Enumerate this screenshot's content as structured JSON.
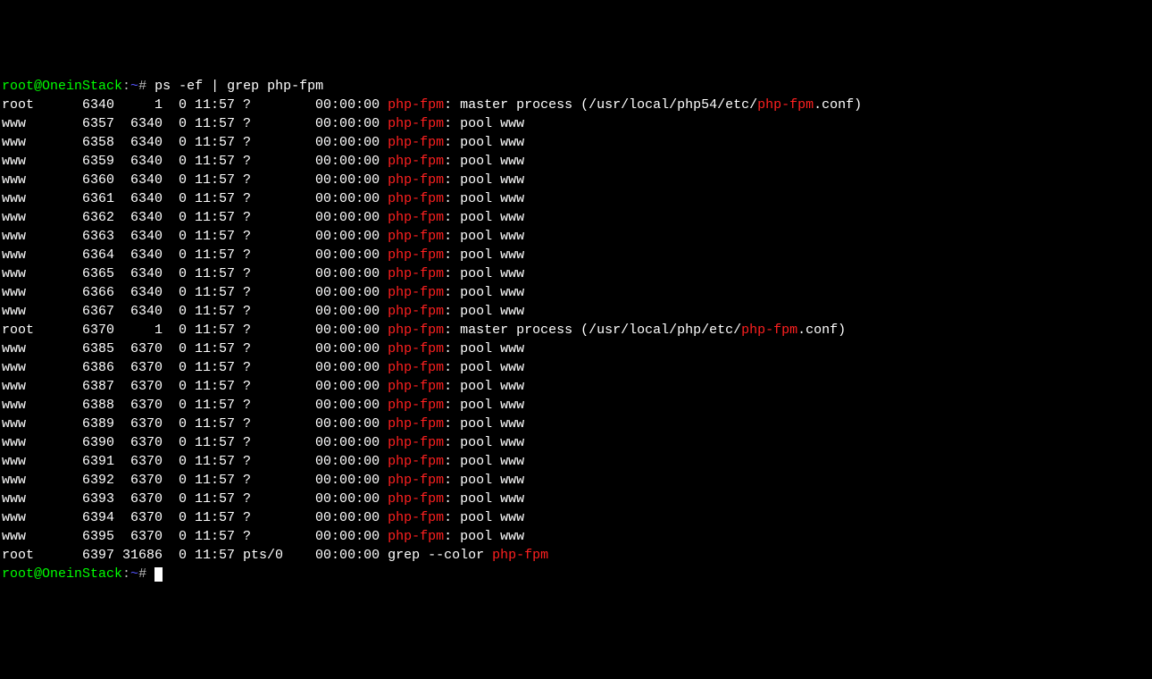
{
  "prompt": {
    "user_host": "root@OneinStack",
    "separator": ":",
    "path": "~",
    "hash": "#",
    "command": " ps -ef | grep php-fpm"
  },
  "final_prompt": {
    "user_host": "root@OneinStack",
    "separator": ":",
    "path": "~",
    "hash": "#"
  },
  "highlight": "php-fpm",
  "processes": [
    {
      "user": "root",
      "pid": "6340",
      "ppid": "1",
      "c": "0",
      "stime": "11:57",
      "tty": "?",
      "time": "00:00:00",
      "cmd_pre": ": master process (/usr/local/php54/etc/",
      "cmd_post": ".conf)"
    },
    {
      "user": "www",
      "pid": "6357",
      "ppid": "6340",
      "c": "0",
      "stime": "11:57",
      "tty": "?",
      "time": "00:00:00",
      "cmd_pre": ": pool www",
      "cmd_post": ""
    },
    {
      "user": "www",
      "pid": "6358",
      "ppid": "6340",
      "c": "0",
      "stime": "11:57",
      "tty": "?",
      "time": "00:00:00",
      "cmd_pre": ": pool www",
      "cmd_post": ""
    },
    {
      "user": "www",
      "pid": "6359",
      "ppid": "6340",
      "c": "0",
      "stime": "11:57",
      "tty": "?",
      "time": "00:00:00",
      "cmd_pre": ": pool www",
      "cmd_post": ""
    },
    {
      "user": "www",
      "pid": "6360",
      "ppid": "6340",
      "c": "0",
      "stime": "11:57",
      "tty": "?",
      "time": "00:00:00",
      "cmd_pre": ": pool www",
      "cmd_post": ""
    },
    {
      "user": "www",
      "pid": "6361",
      "ppid": "6340",
      "c": "0",
      "stime": "11:57",
      "tty": "?",
      "time": "00:00:00",
      "cmd_pre": ": pool www",
      "cmd_post": ""
    },
    {
      "user": "www",
      "pid": "6362",
      "ppid": "6340",
      "c": "0",
      "stime": "11:57",
      "tty": "?",
      "time": "00:00:00",
      "cmd_pre": ": pool www",
      "cmd_post": ""
    },
    {
      "user": "www",
      "pid": "6363",
      "ppid": "6340",
      "c": "0",
      "stime": "11:57",
      "tty": "?",
      "time": "00:00:00",
      "cmd_pre": ": pool www",
      "cmd_post": ""
    },
    {
      "user": "www",
      "pid": "6364",
      "ppid": "6340",
      "c": "0",
      "stime": "11:57",
      "tty": "?",
      "time": "00:00:00",
      "cmd_pre": ": pool www",
      "cmd_post": ""
    },
    {
      "user": "www",
      "pid": "6365",
      "ppid": "6340",
      "c": "0",
      "stime": "11:57",
      "tty": "?",
      "time": "00:00:00",
      "cmd_pre": ": pool www",
      "cmd_post": ""
    },
    {
      "user": "www",
      "pid": "6366",
      "ppid": "6340",
      "c": "0",
      "stime": "11:57",
      "tty": "?",
      "time": "00:00:00",
      "cmd_pre": ": pool www",
      "cmd_post": ""
    },
    {
      "user": "www",
      "pid": "6367",
      "ppid": "6340",
      "c": "0",
      "stime": "11:57",
      "tty": "?",
      "time": "00:00:00",
      "cmd_pre": ": pool www",
      "cmd_post": ""
    },
    {
      "user": "root",
      "pid": "6370",
      "ppid": "1",
      "c": "0",
      "stime": "11:57",
      "tty": "?",
      "time": "00:00:00",
      "cmd_pre": ": master process (/usr/local/php/etc/",
      "cmd_post": ".conf)"
    },
    {
      "user": "www",
      "pid": "6385",
      "ppid": "6370",
      "c": "0",
      "stime": "11:57",
      "tty": "?",
      "time": "00:00:00",
      "cmd_pre": ": pool www",
      "cmd_post": ""
    },
    {
      "user": "www",
      "pid": "6386",
      "ppid": "6370",
      "c": "0",
      "stime": "11:57",
      "tty": "?",
      "time": "00:00:00",
      "cmd_pre": ": pool www",
      "cmd_post": ""
    },
    {
      "user": "www",
      "pid": "6387",
      "ppid": "6370",
      "c": "0",
      "stime": "11:57",
      "tty": "?",
      "time": "00:00:00",
      "cmd_pre": ": pool www",
      "cmd_post": ""
    },
    {
      "user": "www",
      "pid": "6388",
      "ppid": "6370",
      "c": "0",
      "stime": "11:57",
      "tty": "?",
      "time": "00:00:00",
      "cmd_pre": ": pool www",
      "cmd_post": ""
    },
    {
      "user": "www",
      "pid": "6389",
      "ppid": "6370",
      "c": "0",
      "stime": "11:57",
      "tty": "?",
      "time": "00:00:00",
      "cmd_pre": ": pool www",
      "cmd_post": ""
    },
    {
      "user": "www",
      "pid": "6390",
      "ppid": "6370",
      "c": "0",
      "stime": "11:57",
      "tty": "?",
      "time": "00:00:00",
      "cmd_pre": ": pool www",
      "cmd_post": ""
    },
    {
      "user": "www",
      "pid": "6391",
      "ppid": "6370",
      "c": "0",
      "stime": "11:57",
      "tty": "?",
      "time": "00:00:00",
      "cmd_pre": ": pool www",
      "cmd_post": ""
    },
    {
      "user": "www",
      "pid": "6392",
      "ppid": "6370",
      "c": "0",
      "stime": "11:57",
      "tty": "?",
      "time": "00:00:00",
      "cmd_pre": ": pool www",
      "cmd_post": ""
    },
    {
      "user": "www",
      "pid": "6393",
      "ppid": "6370",
      "c": "0",
      "stime": "11:57",
      "tty": "?",
      "time": "00:00:00",
      "cmd_pre": ": pool www",
      "cmd_post": ""
    },
    {
      "user": "www",
      "pid": "6394",
      "ppid": "6370",
      "c": "0",
      "stime": "11:57",
      "tty": "?",
      "time": "00:00:00",
      "cmd_pre": ": pool www",
      "cmd_post": ""
    },
    {
      "user": "www",
      "pid": "6395",
      "ppid": "6370",
      "c": "0",
      "stime": "11:57",
      "tty": "?",
      "time": "00:00:00",
      "cmd_pre": ": pool www",
      "cmd_post": ""
    }
  ],
  "grep_line": {
    "user": "root",
    "pid": "6397",
    "ppid": "31686",
    "c": "0",
    "stime": "11:57",
    "tty": "pts/0",
    "time": "00:00:00",
    "cmd": "grep --color "
  }
}
